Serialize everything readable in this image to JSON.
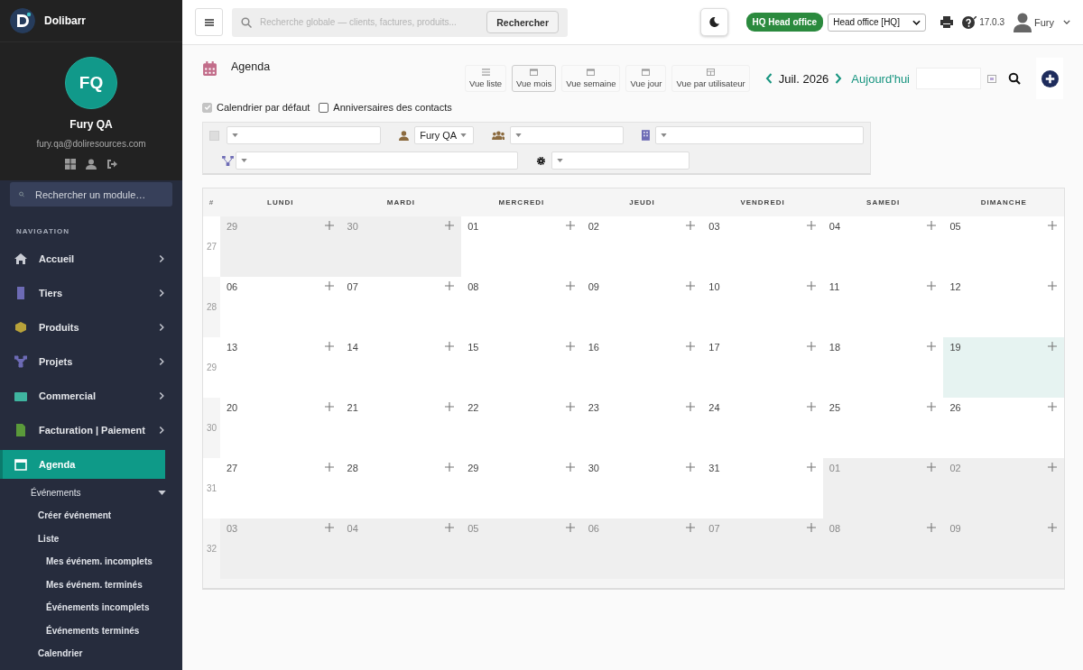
{
  "app": {
    "name": "Dolibarr"
  },
  "user": {
    "initials": "FQ",
    "name": "Fury QA",
    "email": "fury.qa@doliresources.com"
  },
  "module_search": {
    "placeholder": "Rechercher un module…"
  },
  "nav": {
    "heading": "NAVIGATION",
    "items": [
      {
        "label": "Accueil",
        "selected": false
      },
      {
        "label": "Tiers",
        "selected": false
      },
      {
        "label": "Produits",
        "selected": false
      },
      {
        "label": "Projets",
        "selected": false
      },
      {
        "label": "Commercial",
        "selected": false
      },
      {
        "label": "Facturation | Paiement",
        "selected": false
      },
      {
        "label": "Agenda",
        "selected": true,
        "children": [
          {
            "label": "Événements",
            "expanded": true,
            "children": [
              {
                "label": "Créer événement"
              },
              {
                "label": "Liste",
                "children": [
                  {
                    "label": "Mes événem. incomplets"
                  },
                  {
                    "label": "Mes événem. terminés"
                  },
                  {
                    "label": "Événements incomplets"
                  },
                  {
                    "label": "Événements terminés"
                  }
                ]
              },
              {
                "label": "Calendrier"
              }
            ]
          }
        ]
      }
    ]
  },
  "topbar": {
    "search": {
      "placeholder": "Recherche globale — clients, factures, produits...",
      "button": "Rechercher"
    },
    "entity_badge": {
      "code": "HQ",
      "name": "Head office"
    },
    "entity_select": "Head office [HQ]",
    "version": "17.0.3",
    "user": "Fury"
  },
  "page": {
    "title": "Agenda",
    "views": [
      {
        "label": "Vue liste",
        "selected": false
      },
      {
        "label": "Vue mois",
        "selected": true
      },
      {
        "label": "Vue semaine",
        "selected": false
      },
      {
        "label": "Vue jour",
        "selected": false
      },
      {
        "label": "Vue par utilisateur",
        "selected": false
      }
    ],
    "period": "Juil. 2026",
    "today": "Aujourd'hui",
    "calendars": [
      {
        "label": "Calendrier par défaut",
        "checked": true,
        "disabled": true
      },
      {
        "label": "Anniversaires des contacts",
        "checked": false,
        "disabled": false
      }
    ],
    "filters": [
      [
        {
          "kind": "checkbox",
          "checked": false
        },
        {
          "kind": "select"
        },
        {
          "kind": "select",
          "value": "Fury QA"
        },
        {
          "kind": "select"
        },
        {
          "kind": "select"
        }
      ],
      [
        {
          "kind": "select"
        },
        {
          "kind": "select"
        }
      ]
    ]
  },
  "calendar": {
    "columns": [
      "#",
      "LUNDI",
      "MARDI",
      "MERCREDI",
      "JEUDI",
      "VENDREDI",
      "SAMEDI",
      "DIMANCHE"
    ],
    "weeks": [
      {
        "number": "27",
        "days": [
          {
            "day": "29",
            "outside": true,
            "today": false
          },
          {
            "day": "30",
            "outside": true,
            "today": false
          },
          {
            "day": "01",
            "outside": false,
            "today": false
          },
          {
            "day": "02",
            "outside": false,
            "today": false
          },
          {
            "day": "03",
            "outside": false,
            "today": false
          },
          {
            "day": "04",
            "outside": false,
            "today": false
          },
          {
            "day": "05",
            "outside": false,
            "today": false
          }
        ]
      },
      {
        "number": "28",
        "days": [
          {
            "day": "06",
            "outside": false,
            "today": false
          },
          {
            "day": "07",
            "outside": false,
            "today": false
          },
          {
            "day": "08",
            "outside": false,
            "today": false
          },
          {
            "day": "09",
            "outside": false,
            "today": false
          },
          {
            "day": "10",
            "outside": false,
            "today": false
          },
          {
            "day": "11",
            "outside": false,
            "today": false
          },
          {
            "day": "12",
            "outside": false,
            "today": false
          }
        ]
      },
      {
        "number": "29",
        "days": [
          {
            "day": "13",
            "outside": false,
            "today": false
          },
          {
            "day": "14",
            "outside": false,
            "today": false
          },
          {
            "day": "15",
            "outside": false,
            "today": false
          },
          {
            "day": "16",
            "outside": false,
            "today": false
          },
          {
            "day": "17",
            "outside": false,
            "today": false
          },
          {
            "day": "18",
            "outside": false,
            "today": false
          },
          {
            "day": "19",
            "outside": false,
            "today": true
          }
        ]
      },
      {
        "number": "30",
        "days": [
          {
            "day": "20",
            "outside": false,
            "today": false
          },
          {
            "day": "21",
            "outside": false,
            "today": false
          },
          {
            "day": "22",
            "outside": false,
            "today": false
          },
          {
            "day": "23",
            "outside": false,
            "today": false
          },
          {
            "day": "24",
            "outside": false,
            "today": false
          },
          {
            "day": "25",
            "outside": false,
            "today": false
          },
          {
            "day": "26",
            "outside": false,
            "today": false
          }
        ]
      },
      {
        "number": "31",
        "days": [
          {
            "day": "27",
            "outside": false,
            "today": false
          },
          {
            "day": "28",
            "outside": false,
            "today": false
          },
          {
            "day": "29",
            "outside": false,
            "today": false
          },
          {
            "day": "30",
            "outside": false,
            "today": false
          },
          {
            "day": "31",
            "outside": false,
            "today": false
          },
          {
            "day": "01",
            "outside": true,
            "today": false
          },
          {
            "day": "02",
            "outside": true,
            "today": false
          }
        ]
      },
      {
        "number": "32",
        "days": [
          {
            "day": "03",
            "outside": true,
            "today": false
          },
          {
            "day": "04",
            "outside": true,
            "today": false
          },
          {
            "day": "05",
            "outside": true,
            "today": false
          },
          {
            "day": "06",
            "outside": true,
            "today": false
          },
          {
            "day": "07",
            "outside": true,
            "today": false
          },
          {
            "day": "08",
            "outside": true,
            "today": false
          },
          {
            "day": "09",
            "outside": true,
            "today": false
          }
        ]
      }
    ]
  }
}
